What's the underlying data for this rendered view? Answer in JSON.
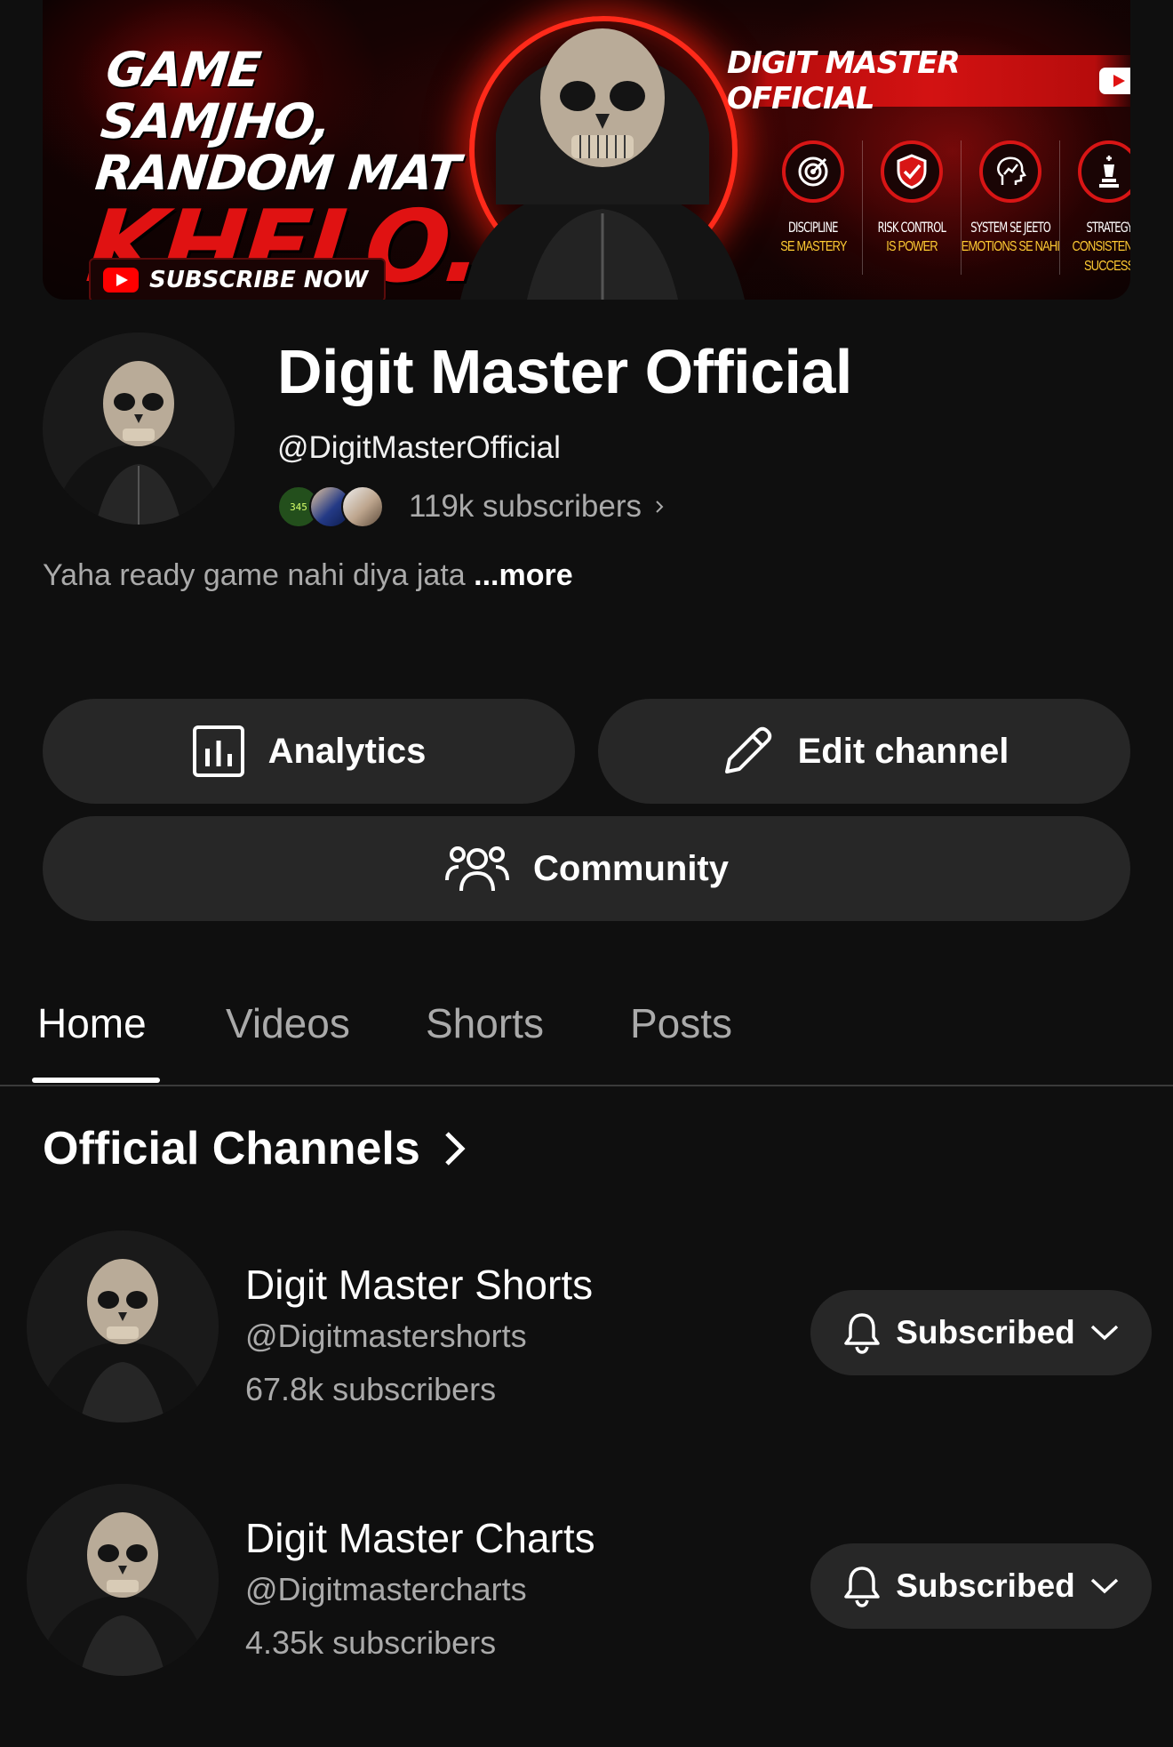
{
  "banner": {
    "tagline": [
      "GAME SAMJHO,",
      "RANDOM MAT",
      "KHELO."
    ],
    "subscribe_now": "SUBSCRIBE NOW",
    "brand": "DIGIT MASTER OFFICIAL",
    "features": [
      {
        "icon": "target-icon",
        "line1": "DISCIPLINE",
        "line2": "SE MASTERY",
        "line3": ""
      },
      {
        "icon": "shield-check-icon",
        "line1": "RISK CONTROL",
        "line2": "IS POWER",
        "line3": ""
      },
      {
        "icon": "brain-chart-icon",
        "line1": "SYSTEM SE JEETO",
        "line2": "EMOTIONS SE NAHI",
        "line3": ""
      },
      {
        "icon": "chess-king-icon",
        "line1": "STRATEGY",
        "line2": "CONSISTENCY",
        "line3": "SUCCESS"
      }
    ]
  },
  "channel": {
    "name": "Digit Master Official",
    "handle": "@DigitMasterOfficial",
    "subscribers": "119k subscribers",
    "description": "Yaha ready game nahi diya jata",
    "more": "...more"
  },
  "actions": {
    "analytics": "Analytics",
    "edit_channel": "Edit channel",
    "community": "Community"
  },
  "tabs": [
    "Home",
    "Videos",
    "Shorts",
    "Posts"
  ],
  "active_tab": "Home",
  "official_channels": {
    "title": "Official Channels",
    "items": [
      {
        "name": "Digit Master Shorts",
        "handle": "@Digitmastershorts",
        "subscribers": "67.8k subscribers",
        "button": "Subscribed"
      },
      {
        "name": "Digit Master Charts",
        "handle": "@Digitmastercharts",
        "subscribers": "4.35k subscribers",
        "button": "Subscribed"
      }
    ]
  },
  "colors": {
    "background": "#0f0f0f",
    "button_bg": "#272727",
    "secondary_text": "#aaaaaa",
    "banner_red": "#e01212",
    "youtube_red": "#ff0000"
  }
}
